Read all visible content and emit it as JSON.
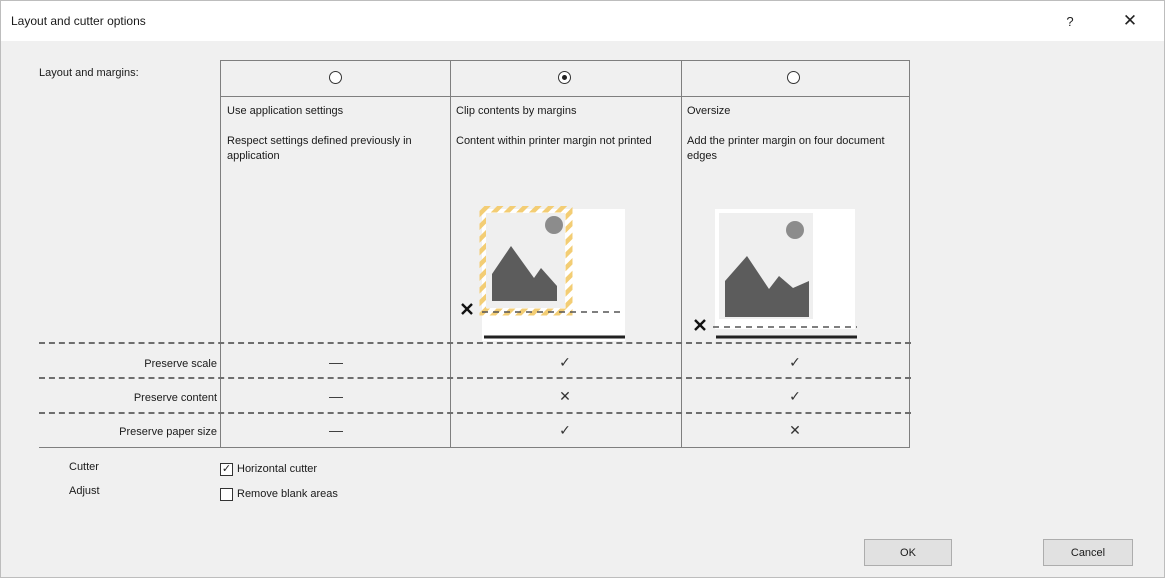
{
  "dialog": {
    "title": "Layout and cutter options",
    "help_glyph": "?",
    "close_glyph": "✕"
  },
  "layout": {
    "label": "Layout and margins:",
    "columns": [
      {
        "title": "Use application settings",
        "description": "Respect settings defined previously in application",
        "selected": false
      },
      {
        "title": "Clip contents by margins",
        "description": "Content within printer margin not printed",
        "selected": true
      },
      {
        "title": "Oversize",
        "description": "Add the printer margin on four document edges",
        "selected": false
      }
    ],
    "rows": [
      {
        "label": "Preserve scale",
        "values": [
          "—",
          "✓",
          "✓"
        ]
      },
      {
        "label": "Preserve content",
        "values": [
          "—",
          "✕",
          "✓"
        ]
      },
      {
        "label": "Preserve paper size",
        "values": [
          "—",
          "✓",
          "✕"
        ]
      }
    ]
  },
  "options": {
    "cutter_label": "Cutter",
    "adjust_label": "Adjust",
    "horizontal_cutter": {
      "label": "Horizontal cutter",
      "checked": true,
      "glyph": "✓"
    },
    "remove_blank_areas": {
      "label": "Remove blank areas",
      "checked": false
    }
  },
  "buttons": {
    "ok": "OK",
    "cancel": "Cancel"
  },
  "colors": {
    "accent_stripe": "#f3cd74",
    "image_gray": "#5c5c5c",
    "sun_gray": "#8c8c8c"
  },
  "icons": [
    "help-icon",
    "close-icon",
    "scissors-icon"
  ]
}
